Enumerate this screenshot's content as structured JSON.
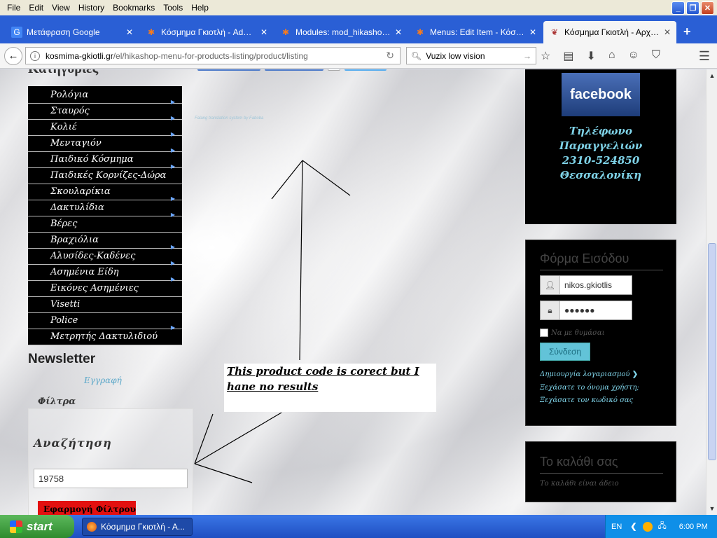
{
  "menubar": [
    "File",
    "Edit",
    "View",
    "History",
    "Bookmarks",
    "Tools",
    "Help"
  ],
  "tabs": [
    {
      "label": "Μετάφραση Google",
      "icon": "google-translate-icon",
      "active": false
    },
    {
      "label": "Κόσμημα Γκιοτλή - Administration",
      "icon": "joomla-icon",
      "active": false
    },
    {
      "label": "Modules: mod_hikashop_f...",
      "icon": "joomla-icon",
      "active": false
    },
    {
      "label": "Menus: Edit Item - Κόσμημα...",
      "icon": "joomla-icon",
      "active": false
    },
    {
      "label": "Κόσμημα Γκιοτλή - Αρχική",
      "icon": "site-favicon",
      "active": true
    }
  ],
  "nav": {
    "url_host": "kosmima-gkiotli.gr",
    "url_path": "/el/hikashop-menu-for-products-listing/product/listing",
    "search_value": "Vuzix low vision"
  },
  "left": {
    "categories_heading": "Κατηγορίες",
    "categories": [
      {
        "label": "Ρολόγια",
        "has_sub": true
      },
      {
        "label": "Σταυρός",
        "has_sub": true
      },
      {
        "label": "Κολιέ",
        "has_sub": true
      },
      {
        "label": "Μενταγιόν",
        "has_sub": true
      },
      {
        "label": "Παιδικό Κόσμημα",
        "has_sub": true
      },
      {
        "label": "Παιδικές Κορνίζες-Δώρα",
        "has_sub": false
      },
      {
        "label": "Σκουλαρίκια",
        "has_sub": true
      },
      {
        "label": "Δακτυλίδια",
        "has_sub": true
      },
      {
        "label": "Βέρες",
        "has_sub": false
      },
      {
        "label": "Βραχιόλια",
        "has_sub": true
      },
      {
        "label": "Αλυσίδες-Καδένες",
        "has_sub": true
      },
      {
        "label": "Ασημένια Είδη",
        "has_sub": true
      },
      {
        "label": "Εικόνες Ασημένιες",
        "has_sub": false
      },
      {
        "label": "Visetti",
        "has_sub": false
      },
      {
        "label": "Police",
        "has_sub": true
      },
      {
        "label": "Μετρητής Δακτυλιδιού",
        "has_sub": false
      }
    ],
    "newsletter": "Newsletter",
    "subscribe": "Εγγραφή",
    "filters_title": "Φίλτρα",
    "search_label": "Αναζήτηση",
    "search_value": "19758",
    "apply_label": "Εφαρμογή Φίλτρου"
  },
  "center": {
    "tiny_text": "Falang translation system by Faboba",
    "note": "This product code is corect but I hane no results"
  },
  "right": {
    "facebook_label": "facebook",
    "phone_lines": [
      "Τηλέφωνο",
      "Παραγγελιών",
      "2310-524850",
      "Θεσσαλονίκη"
    ],
    "login_title": "Φόρμα Εισόδου",
    "username": "nikos.gkiotlis",
    "password": "●●●●●●",
    "remember": "Να με θυμάσαι",
    "login_button": "Σύνδεση",
    "links": [
      "Δημιουργία λογαριασμού",
      "Ξεχάσατε το όνομα χρήστη;",
      "Ξεχάσατε τον κωδικό σας"
    ],
    "cart_title": "Το καλάθι σας",
    "cart_empty": "Το καλάθι είναι άδειο"
  },
  "taskbar": {
    "start": "start",
    "task_item": "Κόσμημα Γκιοτλή - Α...",
    "lang": "EN",
    "clock": "6:00 PM"
  }
}
